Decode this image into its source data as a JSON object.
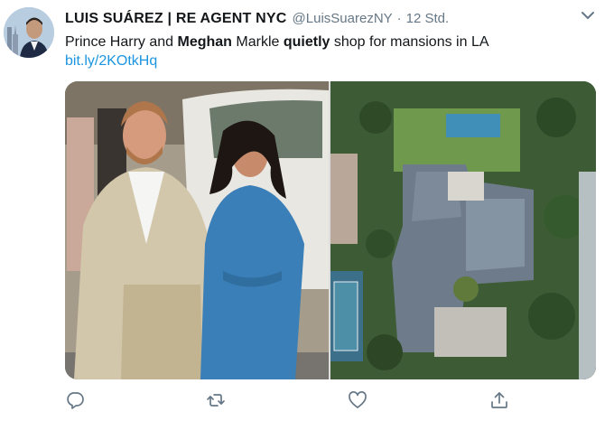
{
  "tweet": {
    "author_name": "LUIS SUÁREZ | RE AGENT NYC",
    "handle": "@LuisSuarezNY",
    "separator": "·",
    "time": "12 Std.",
    "text_parts": {
      "p1": "Prince Harry and ",
      "p2": "Meghan",
      "p3": " Markle ",
      "p4": "quietly",
      "p5": " shop for mansions in LA"
    },
    "link": "bit.ly/2KOtkHq"
  },
  "icons": {
    "menu": "chevron-down-icon",
    "reply": "reply-icon",
    "retweet": "retweet-icon",
    "like": "heart-icon",
    "share": "share-icon"
  },
  "colors": {
    "link": "#1b95e0",
    "secondary_text": "#657786",
    "icon": "#657786"
  }
}
